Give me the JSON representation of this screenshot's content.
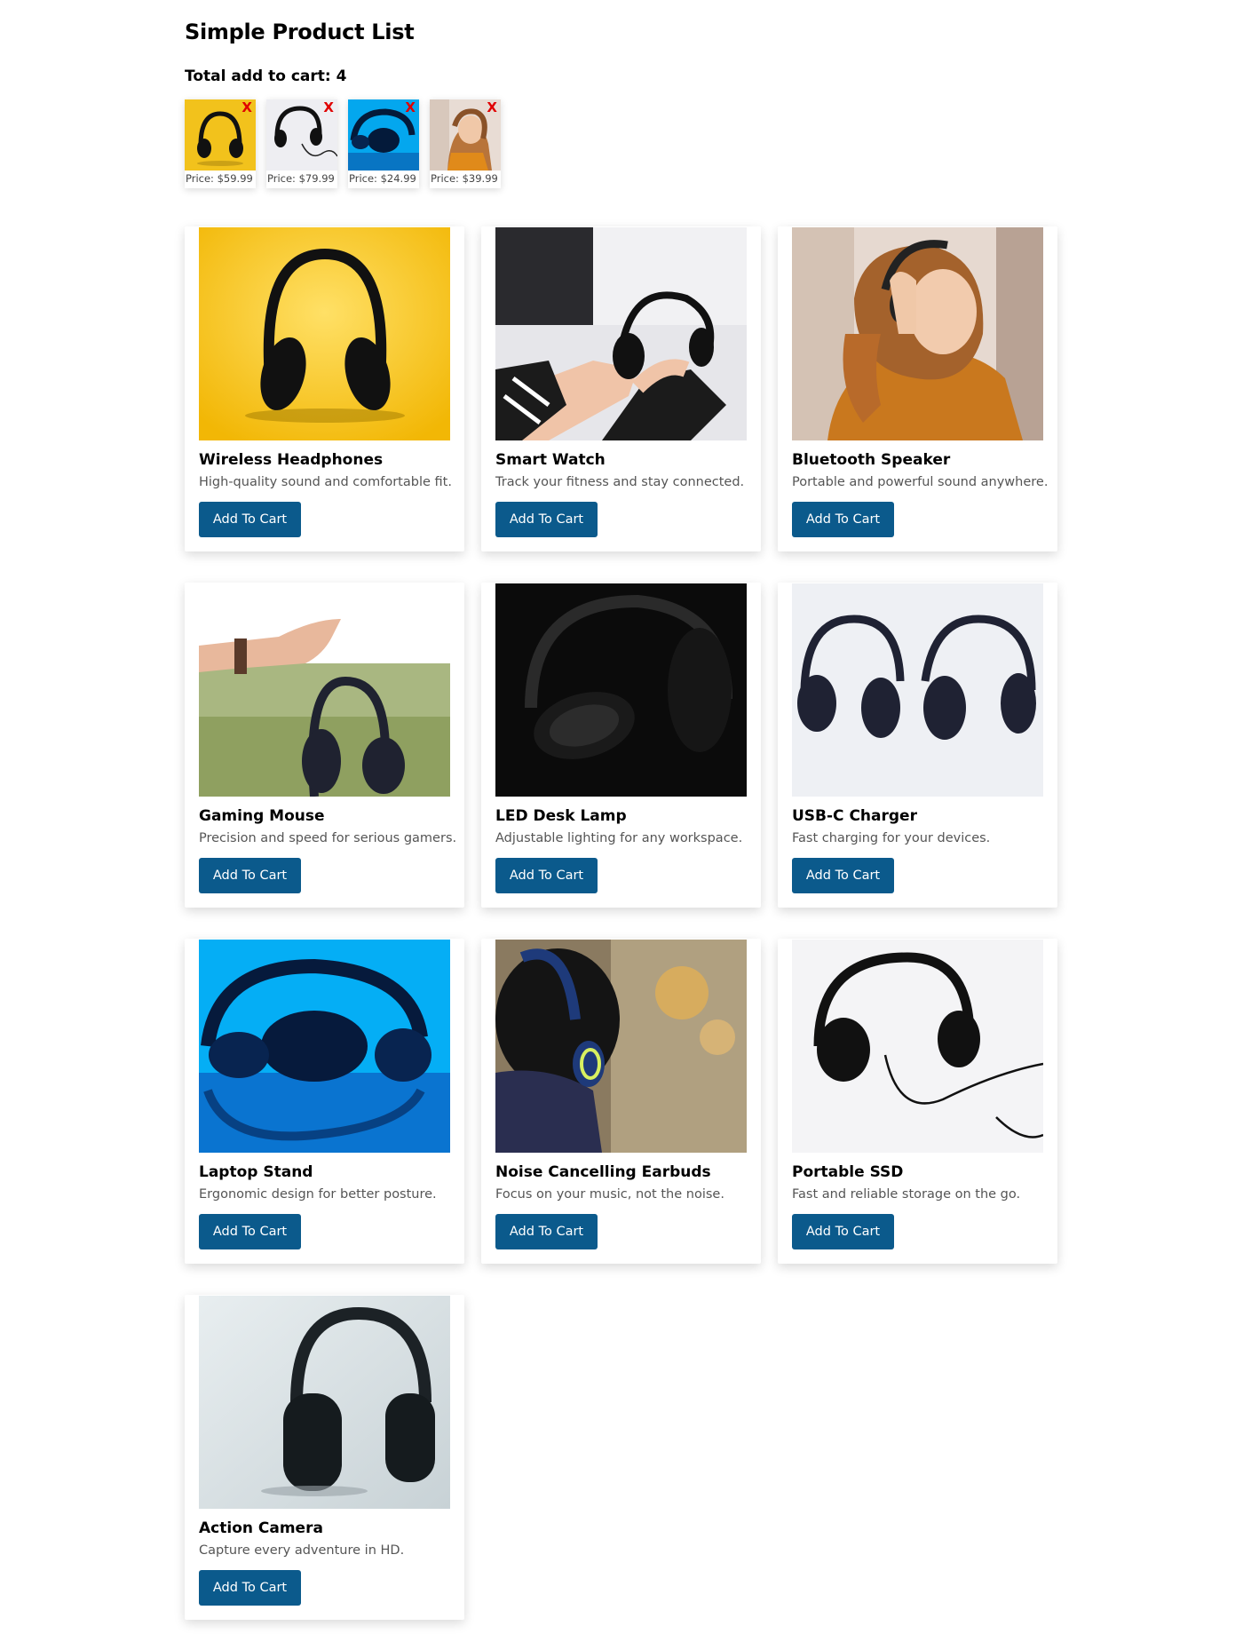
{
  "page": {
    "title": "Simple Product List",
    "cart_total_label": "Total add to cart: 4"
  },
  "cart": {
    "remove_label": "X",
    "items": [
      {
        "price": "Price: $59.99",
        "image": "yellow-headphones"
      },
      {
        "price": "Price: $79.99",
        "image": "white-headphones"
      },
      {
        "price": "Price: $24.99",
        "image": "blue-headphones"
      },
      {
        "price": "Price: $39.99",
        "image": "woman-headphones"
      }
    ]
  },
  "products": [
    {
      "name": "Wireless Headphones",
      "description": "High-quality sound and comfortable fit.",
      "button": "Add To Cart",
      "image": "yellow-headphones"
    },
    {
      "name": "Smart Watch",
      "description": "Track your fitness and stay connected.",
      "button": "Add To Cart",
      "image": "hands-headphones"
    },
    {
      "name": "Bluetooth Speaker",
      "description": "Portable and powerful sound anywhere.",
      "button": "Add To Cart",
      "image": "woman-headphones"
    },
    {
      "name": "Gaming Mouse",
      "description": "Precision and speed for serious gamers.",
      "button": "Add To Cart",
      "image": "hand-holding-headphones"
    },
    {
      "name": "LED Desk Lamp",
      "description": "Adjustable lighting for any workspace.",
      "button": "Add To Cart",
      "image": "dark-headphones"
    },
    {
      "name": "USB-C Charger",
      "description": "Fast charging for your devices.",
      "button": "Add To Cart",
      "image": "two-headphones"
    },
    {
      "name": "Laptop Stand",
      "description": "Ergonomic design for better posture.",
      "button": "Add To Cart",
      "image": "blue-headphones"
    },
    {
      "name": "Noise Cancelling Earbuds",
      "description": "Focus on your music, not the noise.",
      "button": "Add To Cart",
      "image": "person-headphones"
    },
    {
      "name": "Portable SSD",
      "description": "Fast and reliable storage on the go.",
      "button": "Add To Cart",
      "image": "white-headphones"
    },
    {
      "name": "Action Camera",
      "description": "Capture every adventure in HD.",
      "button": "Add To Cart",
      "image": "gray-headphones"
    }
  ],
  "colors": {
    "button_bg": "#0b5a8c",
    "remove_x": "#e00000"
  }
}
